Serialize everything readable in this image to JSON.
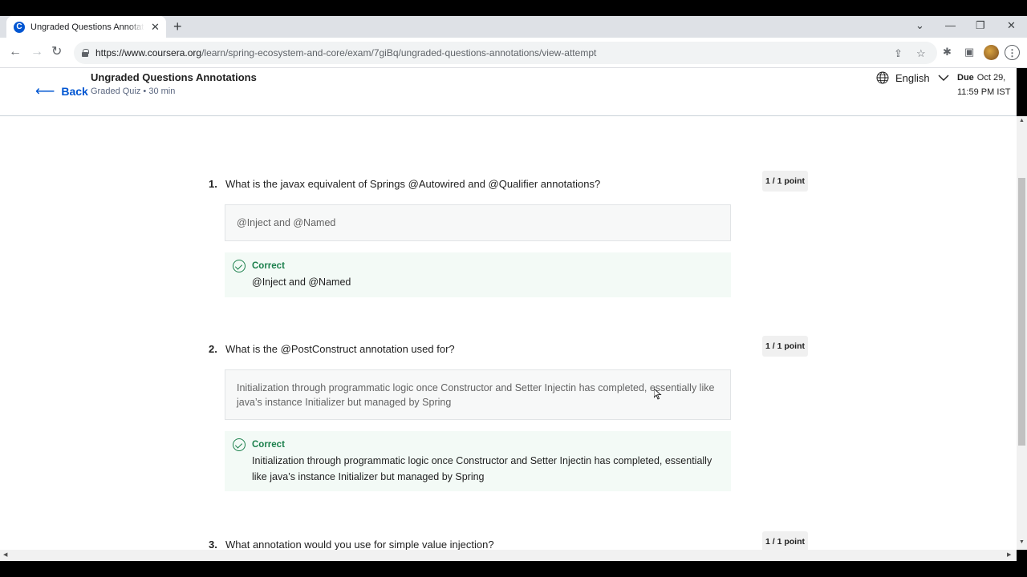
{
  "browser": {
    "tab_title": "Ungraded Questions Annotations",
    "url_domain": "https://www.coursera.org",
    "url_path": "/learn/spring-ecosystem-and-core/exam/7giBq/ungraded-questions-annotations/view-attempt",
    "favicon_letter": "C",
    "tab_close": "✕",
    "new_tab": "+",
    "tab_search": "⌄",
    "minimize": "—",
    "restore": "❐",
    "close": "✕",
    "back": "←",
    "forward": "→",
    "reload": "↻",
    "share": "⇪",
    "star": "☆",
    "extensions": "✱",
    "sidepanel": "▣",
    "menu": "⋮"
  },
  "header": {
    "back_label": "Back",
    "title": "Ungraded Questions Annotations",
    "subtitle": "Graded Quiz • 30 min",
    "language": "English",
    "due_label": "Due",
    "due_date": "Oct 29,",
    "due_time": "11:59 PM IST"
  },
  "questions": [
    {
      "number": "1.",
      "text": "What is the javax equivalent of Springs @Autowired and @Qualifier annotations?",
      "points": "1 / 1 point",
      "answer": "@Inject and @Named",
      "feedback_label": "Correct",
      "feedback_text": "@Inject and @Named"
    },
    {
      "number": "2.",
      "text": "What is the @PostConstruct annotation used for?",
      "points": "1 / 1 point",
      "answer": "Initialization through programmatic logic once Constructor and Setter Injectin has completed, essentially like java’s instance Initializer but managed by Spring",
      "feedback_label": "Correct",
      "feedback_text": "Initialization through programmatic logic once Constructor and Setter Injectin has completed, essentially like java’s instance Initializer but managed by Spring"
    },
    {
      "number": "3.",
      "text": "What annotation would you use for simple value injection?",
      "points": "1 / 1 point"
    }
  ],
  "colors": {
    "link": "#0056d2",
    "correct": "#1a7f4b"
  }
}
